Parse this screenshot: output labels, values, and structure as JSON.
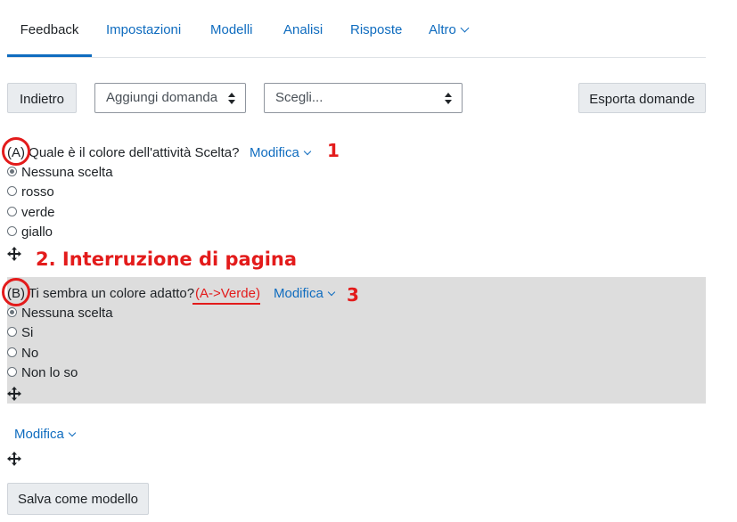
{
  "tabs": [
    {
      "label": "Feedback",
      "active": true
    },
    {
      "label": "Impostazioni"
    },
    {
      "label": "Modelli"
    },
    {
      "label": "Analisi"
    },
    {
      "label": "Risposte"
    },
    {
      "label": "Altro"
    }
  ],
  "toolbar": {
    "back_label": "Indietro",
    "add_question_select": "Aggiungi domanda",
    "choose_select": "Scegli...",
    "export_label": "Esporta domande"
  },
  "question_a": {
    "marker": "(A)",
    "text": "Quale è il colore dell'attività Scelta?",
    "edit_label": "Modifica",
    "options": [
      "Nessuna scelta",
      "rosso",
      "verde",
      "giallo"
    ],
    "selected_index": 0
  },
  "question_b": {
    "marker": "(B)",
    "text": "Ti sembra un colore adatto?",
    "dependency": "(A->Verde)",
    "edit_label": "Modifica",
    "options": [
      "Nessuna scelta",
      "Si",
      "No",
      "Non lo so"
    ],
    "selected_index": 0
  },
  "page_break": {
    "edit_label": "Modifica"
  },
  "save_template_label": "Salva come modello",
  "annotations": {
    "one": "1",
    "two": "2. Interruzione di pagina",
    "three": "3"
  },
  "colors": {
    "link": "#0f6cbf",
    "annotation_red": "#e31b1b",
    "highlight_grey": "#dddddd"
  }
}
